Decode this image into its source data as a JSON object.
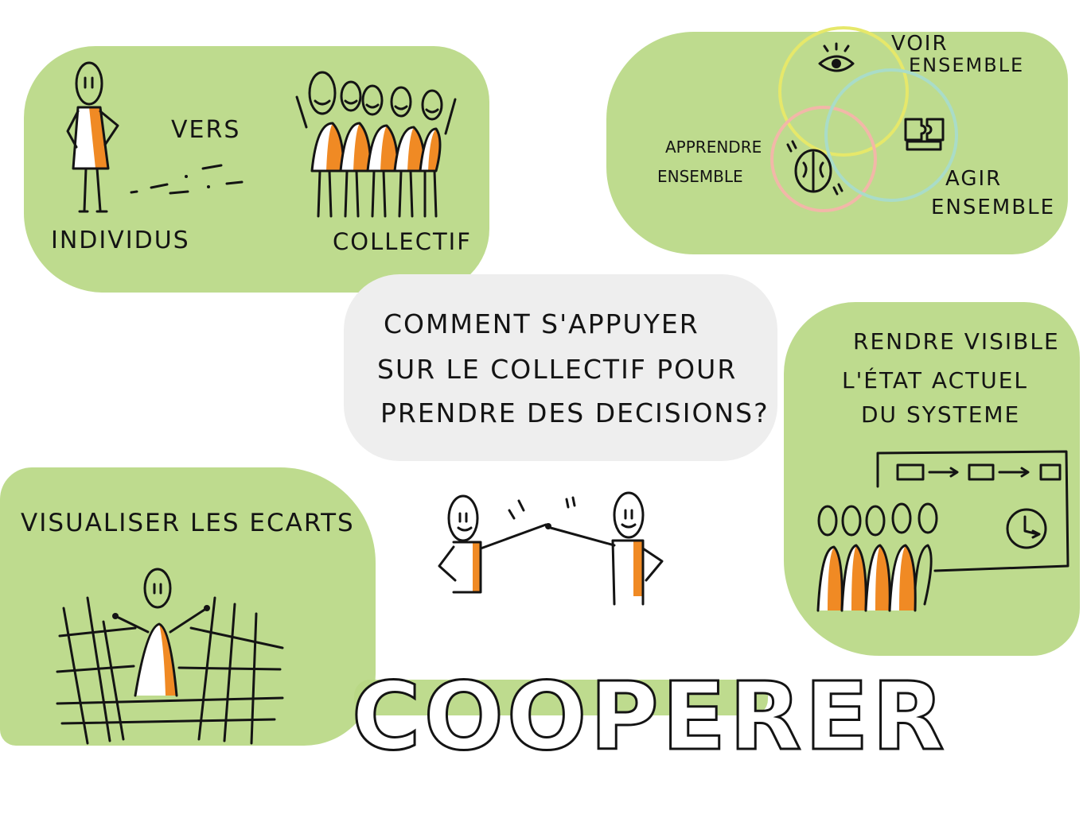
{
  "panels": {
    "individus_collectif": {
      "vers": "VERS",
      "individus": "INDIVIDUS",
      "collectif": "COLLECTIF"
    },
    "ensemble": {
      "voir": "VOIR",
      "voir2": "ENSEMBLE",
      "apprendre": "APPRENDRE",
      "apprendre2": "ENSEMBLE",
      "agir": "AGIR",
      "agir2": "ENSEMBLE"
    },
    "question": {
      "line1": "COMMENT S'APPUYER",
      "line2": "SUR LE COLLECTIF POUR",
      "line3": "PRENDRE DES DECISIONS?"
    },
    "visible": {
      "line1": "RENDRE VISIBLE",
      "line2": "L'ÉTAT ACTUEL",
      "line3": "DU SYSTEME"
    },
    "ecarts": {
      "title": "VISUALISER LES ECARTS"
    }
  },
  "title": "COOPERER",
  "colors": {
    "green": "#b9d884",
    "orange": "#f08a24",
    "ink": "#141414",
    "gray_bubble": "#eeeeee"
  },
  "icons": [
    "eye-icon",
    "puzzle-icon",
    "brain-icon",
    "clock-icon"
  ]
}
